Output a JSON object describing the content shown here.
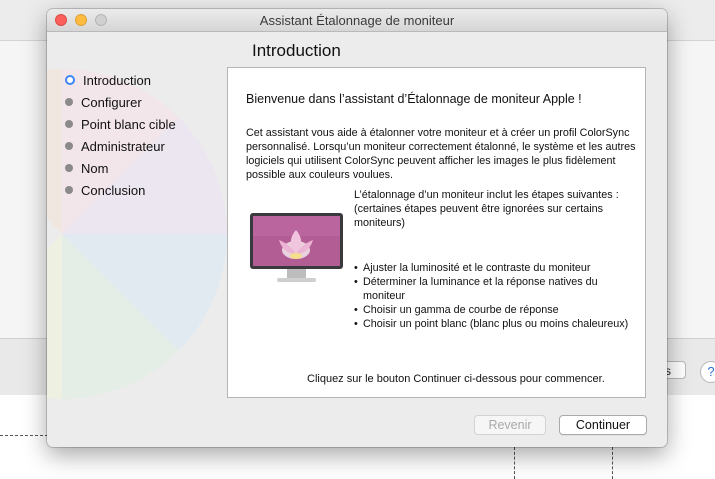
{
  "window": {
    "title": "Assistant Étalonnage de moniteur"
  },
  "page": {
    "heading": "Introduction"
  },
  "steps": [
    {
      "label": "Introduction",
      "active": true
    },
    {
      "label": "Configurer",
      "active": false
    },
    {
      "label": "Point blanc cible",
      "active": false
    },
    {
      "label": "Administrateur",
      "active": false
    },
    {
      "label": "Nom",
      "active": false
    },
    {
      "label": "Conclusion",
      "active": false
    }
  ],
  "content": {
    "welcome": "Bienvenue dans l’assistant d’Étalonnage de moniteur Apple !",
    "paragraph": "Cet assistant vous aide à étalonner votre moniteur et à créer un profil ColorSync personnalisé. Lorsqu’un moniteur correctement étalonné, le système et les autres logiciels qui utilisent ColorSync peuvent afficher les images le plus fidèlement possible aux couleurs voulues.",
    "steps_intro": "L’étalonnage d’un moniteur inclut les étapes suivantes :",
    "steps_note": "(certaines étapes peuvent être ignorées sur certains moniteurs)",
    "step_items": [
      "Ajuster la luminosité et le contraste du moniteur",
      "Déterminer la luminance et la réponse natives du moniteur",
      "Choisir un gamma de courbe de réponse",
      "Choisir un point blanc (blanc plus ou moins chaleureux)"
    ],
    "closing": "Cliquez sur le bouton Continuer ci-dessous pour commencer.",
    "monitor_image": "monitor-lotus-icon"
  },
  "buttons": {
    "back": "Revenir",
    "continue": "Continuer"
  },
  "background": {
    "button_fragment": "s",
    "help_glyph": "?"
  },
  "colors": {
    "accent": "#3d87f5",
    "close": "#fc605c",
    "minimize": "#fdbc40"
  }
}
